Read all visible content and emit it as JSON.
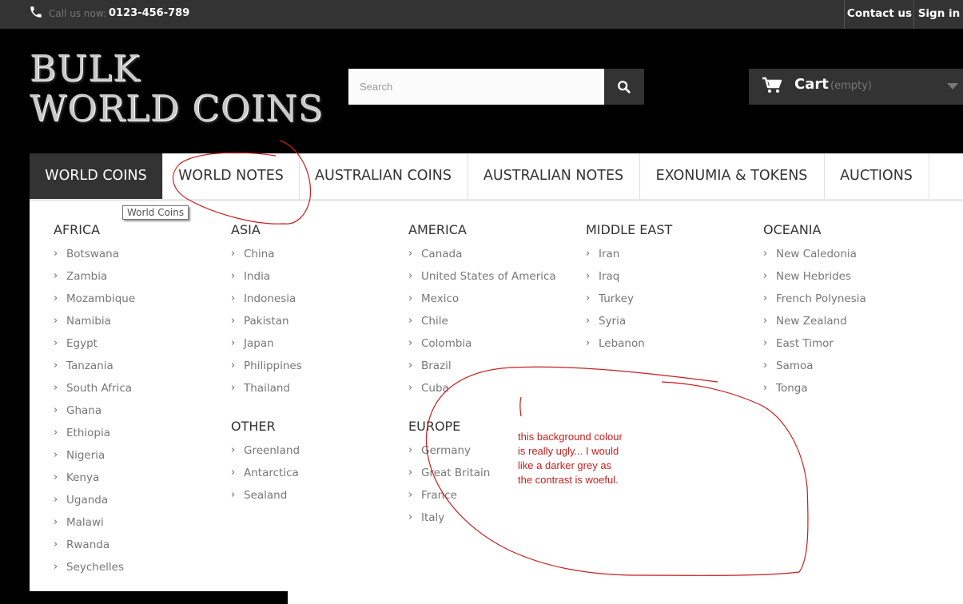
{
  "topbar": {
    "call_label": "Call us now:",
    "call_number": "0123-456-789",
    "contact_label": "Contact us",
    "signin_label": "Sign in"
  },
  "header": {
    "logo_line1": "BULK",
    "logo_line2": "WORLD COINS",
    "search_placeholder": "Search",
    "cart_label": "Cart",
    "cart_status": "(empty)"
  },
  "menu": {
    "items": [
      {
        "label": "WORLD COINS",
        "active": true
      },
      {
        "label": "WORLD NOTES"
      },
      {
        "label": "AUSTRALIAN COINS"
      },
      {
        "label": "AUSTRALIAN NOTES"
      },
      {
        "label": "EXONUMIA & TOKENS"
      },
      {
        "label": "AUCTIONS"
      }
    ],
    "tooltip": "World Coins"
  },
  "dropdown": {
    "africa": {
      "title": "AFRICA",
      "items": [
        "Botswana",
        "Zambia",
        "Mozambique",
        "Namibia",
        "Egypt",
        "Tanzania",
        "South Africa",
        "Ghana",
        "Ethiopia",
        "Nigeria",
        "Kenya",
        "Uganda",
        "Malawi",
        "Rwanda",
        "Seychelles"
      ]
    },
    "asia": {
      "title": "ASIA",
      "items": [
        "China",
        "India",
        "Indonesia",
        "Pakistan",
        "Japan",
        "Philippines",
        "Thailand"
      ]
    },
    "other": {
      "title": "OTHER",
      "items": [
        "Greenland",
        "Antarctica",
        "Sealand"
      ]
    },
    "america": {
      "title": "AMERICA",
      "items": [
        "Canada",
        "United States of America",
        "Mexico",
        "Chile",
        "Colombia",
        "Brazil",
        "Cuba"
      ]
    },
    "europe": {
      "title": "EUROPE",
      "items": [
        "Germany",
        "Great Britain",
        "France",
        "Italy"
      ]
    },
    "middle_east": {
      "title": "MIDDLE EAST",
      "items": [
        "Iran",
        "Iraq",
        "Turkey",
        "Syria",
        "Lebanon"
      ]
    },
    "oceania": {
      "title": "OCEANIA",
      "items": [
        "New Caledonia",
        "New Hebrides",
        "French Polynesia",
        "New Zealand",
        "East Timor",
        "Samoa",
        "Tonga"
      ]
    }
  },
  "annotation": {
    "line1": "this background colour",
    "line2": "is really ugly... I would",
    "line3": "like a darker grey as",
    "line4": "the contrast is woeful.",
    "color": "#c81e1e"
  }
}
